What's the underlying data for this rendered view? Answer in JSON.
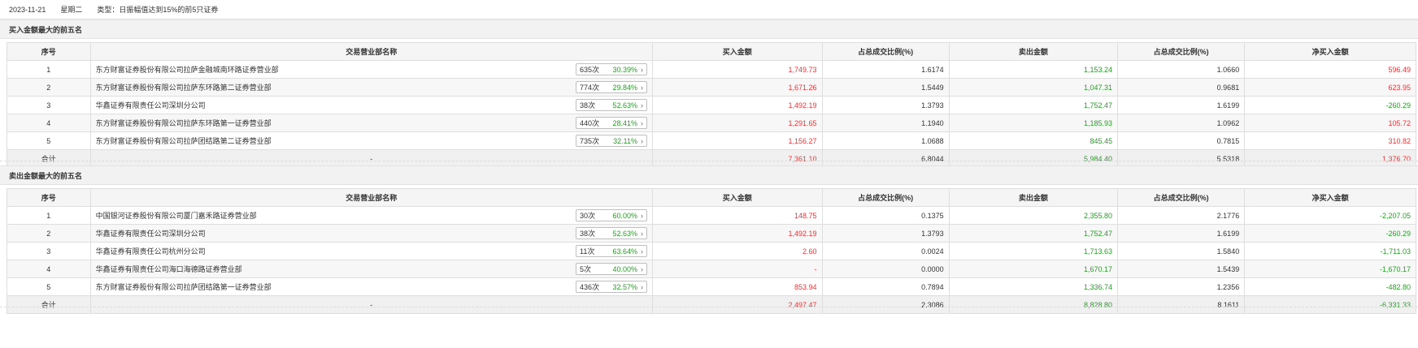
{
  "header": {
    "date": "2023-11-21",
    "weekday": "星期二",
    "type_label": "类型：",
    "type_value": "日振幅值达到15%的前5只证券"
  },
  "columns": [
    "序号",
    "交易营业部名称",
    "买入金额",
    "占总成交比例(%)",
    "卖出金额",
    "占总成交比例(%)",
    "净买入金额"
  ],
  "buy_section": {
    "title": "买入金额最大的前五名",
    "rows": [
      {
        "idx": "1",
        "name": "东方财富证券股份有限公司拉萨金融城南环路证券营业部",
        "count": "635次",
        "pct": "30.39%",
        "buy": "1,749.73",
        "buy_ratio": "1.6174",
        "sell": "1,153.24",
        "sell_ratio": "1.0660",
        "net": "596.49",
        "net_color": "red"
      },
      {
        "idx": "2",
        "name": "东方财富证券股份有限公司拉萨东环路第二证券营业部",
        "count": "774次",
        "pct": "29.84%",
        "buy": "1,671.26",
        "buy_ratio": "1.5449",
        "sell": "1,047.31",
        "sell_ratio": "0.9681",
        "net": "623.95",
        "net_color": "red"
      },
      {
        "idx": "3",
        "name": "华鑫证券有限责任公司深圳分公司",
        "count": "38次",
        "pct": "52.63%",
        "buy": "1,492.19",
        "buy_ratio": "1.3793",
        "sell": "1,752.47",
        "sell_ratio": "1.6199",
        "net": "-260.29",
        "net_color": "green"
      },
      {
        "idx": "4",
        "name": "东方财富证券股份有限公司拉萨东环路第一证券营业部",
        "count": "440次",
        "pct": "28.41%",
        "buy": "1,291.65",
        "buy_ratio": "1.1940",
        "sell": "1,185.93",
        "sell_ratio": "1.0962",
        "net": "105.72",
        "net_color": "red"
      },
      {
        "idx": "5",
        "name": "东方财富证券股份有限公司拉萨团结路第二证券营业部",
        "count": "735次",
        "pct": "32.11%",
        "buy": "1,156.27",
        "buy_ratio": "1.0688",
        "sell": "845.45",
        "sell_ratio": "0.7815",
        "net": "310.82",
        "net_color": "red"
      }
    ],
    "total": {
      "label": "合计",
      "name": "-",
      "buy": "7,361.10",
      "buy_ratio": "6.8044",
      "sell": "5,984.40",
      "sell_ratio": "5.5318",
      "net": "1,376.70",
      "net_color": "red"
    }
  },
  "sell_section": {
    "title": "卖出金额最大的前五名",
    "rows": [
      {
        "idx": "1",
        "name": "中国银河证券股份有限公司厦门嘉禾路证券营业部",
        "count": "30次",
        "pct": "60.00%",
        "buy": "148.75",
        "buy_ratio": "0.1375",
        "sell": "2,355.80",
        "sell_ratio": "2.1776",
        "net": "-2,207.05",
        "net_color": "green"
      },
      {
        "idx": "2",
        "name": "华鑫证券有限责任公司深圳分公司",
        "count": "38次",
        "pct": "52.63%",
        "buy": "1,492.19",
        "buy_ratio": "1.3793",
        "sell": "1,752.47",
        "sell_ratio": "1.6199",
        "net": "-260.29",
        "net_color": "green"
      },
      {
        "idx": "3",
        "name": "华鑫证券有限责任公司杭州分公司",
        "count": "11次",
        "pct": "63.64%",
        "buy": "2.60",
        "buy_ratio": "0.0024",
        "sell": "1,713.63",
        "sell_ratio": "1.5840",
        "net": "-1,711.03",
        "net_color": "green"
      },
      {
        "idx": "4",
        "name": "华鑫证券有限责任公司海口海德路证券营业部",
        "count": "5次",
        "pct": "40.00%",
        "buy": "-",
        "buy_ratio": "0.0000",
        "sell": "1,670.17",
        "sell_ratio": "1.5439",
        "net": "-1,670.17",
        "net_color": "green"
      },
      {
        "idx": "5",
        "name": "东方财富证券股份有限公司拉萨团结路第一证券营业部",
        "count": "436次",
        "pct": "32.57%",
        "buy": "853.94",
        "buy_ratio": "0.7894",
        "sell": "1,336.74",
        "sell_ratio": "1.2356",
        "net": "-482.80",
        "net_color": "green"
      }
    ],
    "total": {
      "label": "合计",
      "name": "-",
      "buy": "2,497.47",
      "buy_ratio": "2.3086",
      "sell": "8,828.80",
      "sell_ratio": "8.1611",
      "net": "-6,331.33",
      "net_color": "green"
    }
  },
  "colors": {
    "positive": "#e4393c",
    "negative": "#2c9a2c"
  },
  "icons": {
    "badge_arrow": "chevron-right-icon"
  }
}
